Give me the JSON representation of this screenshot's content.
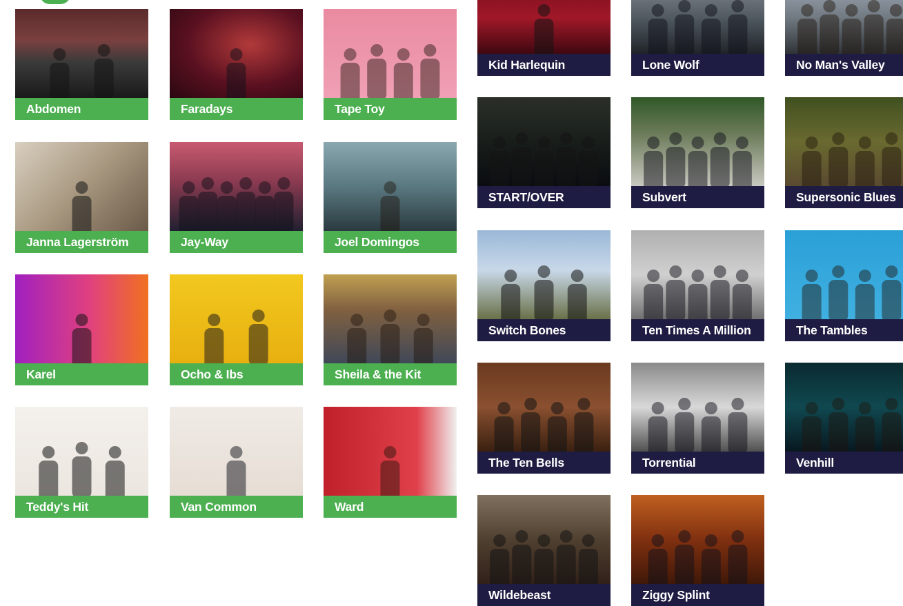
{
  "colors": {
    "green_label": "#4caf50",
    "navy_label": "#1e1c42"
  },
  "left_grid": {
    "label_color": "green",
    "artists": [
      {
        "name": "Abdomen",
        "photo": "street-duo-photo"
      },
      {
        "name": "Faradays",
        "photo": "red-portrait-photo"
      },
      {
        "name": "Tape Toy",
        "photo": "colorful-band-photo"
      },
      {
        "name": "Janna Lagerström",
        "photo": "portrait-photo"
      },
      {
        "name": "Jay-Way",
        "photo": "group-pink-wall-photo"
      },
      {
        "name": "Joel Domingos",
        "photo": "stairway-portrait-photo"
      },
      {
        "name": "Karel",
        "photo": "gradient-window-photo"
      },
      {
        "name": "Ocho & Ibs",
        "photo": "yellow-duo-photo"
      },
      {
        "name": "Sheila & the Kit",
        "photo": "vending-machine-band-photo"
      },
      {
        "name": "Teddy's Hit",
        "photo": "trio-white-photo"
      },
      {
        "name": "Van Common",
        "photo": "white-portrait-photo"
      },
      {
        "name": "Ward",
        "photo": "red-wall-portrait-photo"
      }
    ]
  },
  "right_grid": {
    "label_color": "navy",
    "artists": [
      {
        "name": "Kid Harlequin",
        "photo": "red-stage-photo"
      },
      {
        "name": "Lone Wolf",
        "photo": "band-building-photo"
      },
      {
        "name": "No Man's Valley",
        "photo": "band-sky-photo"
      },
      {
        "name": "START/OVER",
        "photo": "dark-forest-band-photo"
      },
      {
        "name": "Subvert",
        "photo": "band-trees-photo"
      },
      {
        "name": "Supersonic Blues",
        "photo": "band-greenery-photo"
      },
      {
        "name": "Switch Bones",
        "photo": "white-dress-band-photo"
      },
      {
        "name": "Ten Times A Million",
        "photo": "band-wet-ground-photo"
      },
      {
        "name": "The Tambles",
        "photo": "band-blue-wall-photo"
      },
      {
        "name": "The Ten Bells",
        "photo": "band-church-photo"
      },
      {
        "name": "Torrential",
        "photo": "bw-band-photo"
      },
      {
        "name": "Venhill",
        "photo": "teal-double-exposure-photo"
      },
      {
        "name": "Wildebeast",
        "photo": "band-closeup-photo"
      },
      {
        "name": "Ziggy Splint",
        "photo": "band-alley-photo"
      }
    ]
  }
}
